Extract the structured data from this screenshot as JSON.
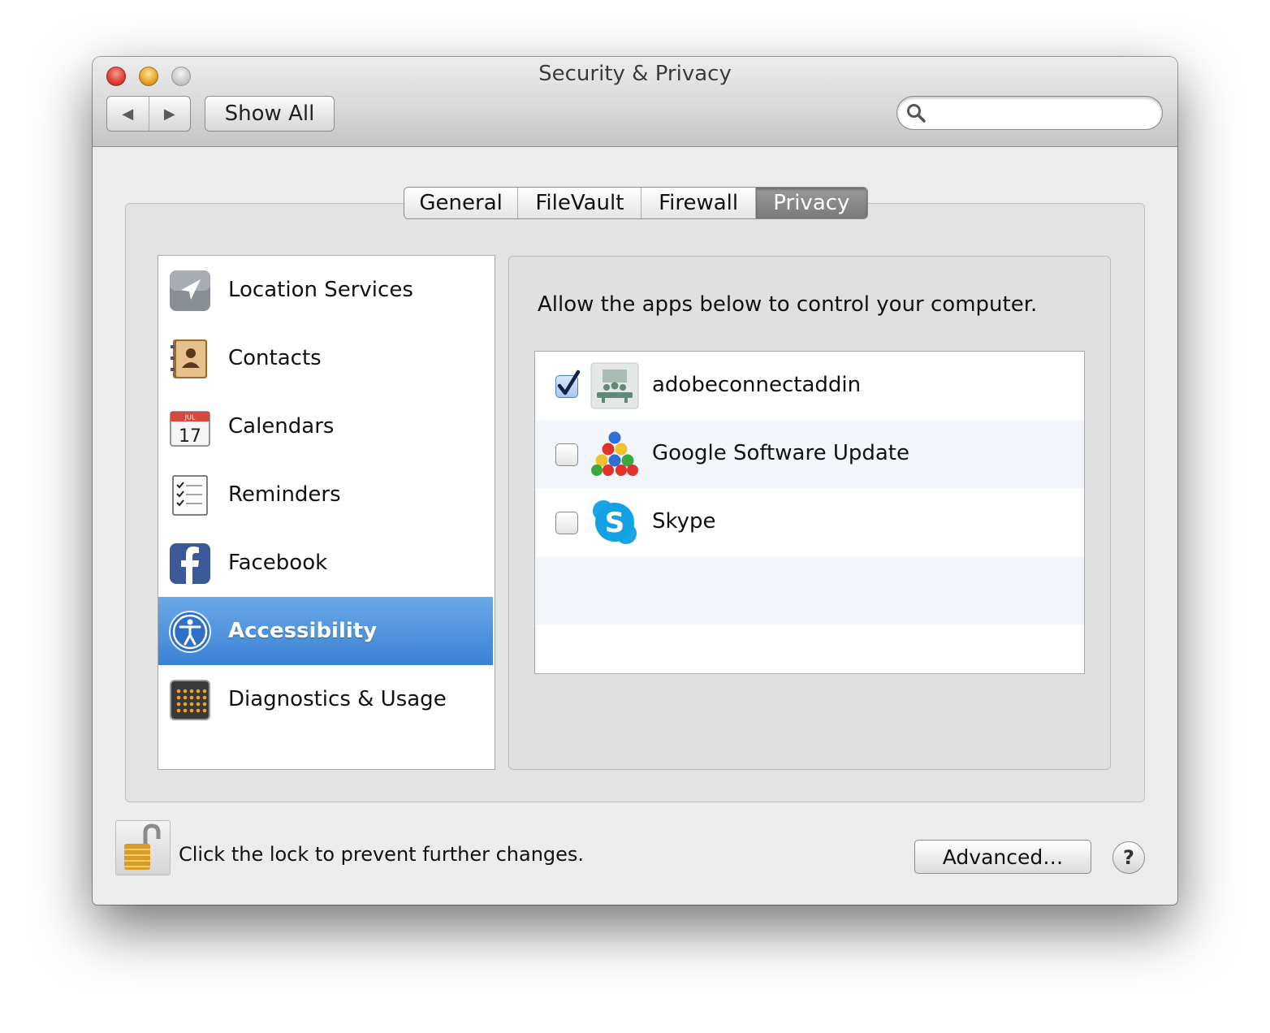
{
  "window": {
    "title": "Security & Privacy"
  },
  "toolbar": {
    "back_glyph": "◀",
    "forward_glyph": "▶",
    "show_all_label": "Show All",
    "search_value": "",
    "search_placeholder": ""
  },
  "tabs": [
    {
      "label": "General",
      "active": false
    },
    {
      "label": "FileVault",
      "active": false
    },
    {
      "label": "Firewall",
      "active": false
    },
    {
      "label": "Privacy",
      "active": true
    }
  ],
  "sidebar": {
    "items": [
      {
        "label": "Location Services",
        "icon": "location-arrow-icon",
        "selected": false
      },
      {
        "label": "Contacts",
        "icon": "contacts-book-icon",
        "selected": false
      },
      {
        "label": "Calendars",
        "icon": "calendar-icon",
        "selected": false,
        "icon_month": "JUL",
        "icon_day": "17"
      },
      {
        "label": "Reminders",
        "icon": "reminders-checklist-icon",
        "selected": false
      },
      {
        "label": "Facebook",
        "icon": "facebook-icon",
        "selected": false
      },
      {
        "label": "Accessibility",
        "icon": "accessibility-icon",
        "selected": true
      },
      {
        "label": "Diagnostics & Usage",
        "icon": "diagnostics-icon",
        "selected": false
      }
    ]
  },
  "main": {
    "description": "Allow the apps below to control your computer.",
    "apps": [
      {
        "name": "adobeconnectaddin",
        "checked": true,
        "icon": "adobe-connect-icon"
      },
      {
        "name": "Google Software Update",
        "checked": false,
        "icon": "google-software-update-icon"
      },
      {
        "name": "Skype",
        "checked": false,
        "icon": "skype-icon"
      }
    ]
  },
  "footer": {
    "lock_text": "Click the lock to prevent further changes.",
    "advanced_label": "Advanced…",
    "help_label": "?"
  },
  "colors": {
    "selection_top": "#6aa9e8",
    "selection_bottom": "#3b82d6",
    "window_bg": "#ececec",
    "close": "#e0433a",
    "minimize": "#e9a630",
    "zoom": "#c8c8c8"
  }
}
